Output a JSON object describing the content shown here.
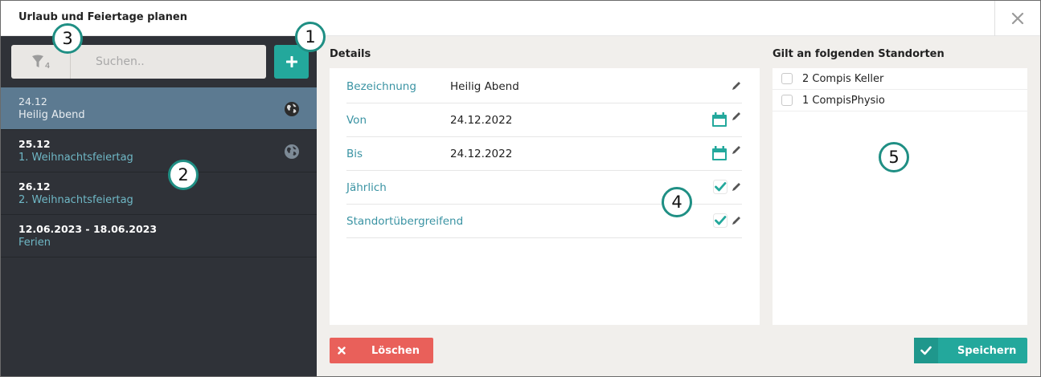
{
  "dialog": {
    "title": "Urlaub und Feiertage planen",
    "close_icon": "close-icon"
  },
  "sidebar": {
    "filter_count": "4",
    "search_placeholder": "Suchen..",
    "items": [
      {
        "date": "24.12",
        "name": "Heilig Abend",
        "icon": "globe-icon",
        "selected": true
      },
      {
        "date": "25.12",
        "name": "1. Weihnachtsfeiertag",
        "icon": "globe-icon",
        "selected": false
      },
      {
        "date": "26.12",
        "name": "2. Weihnachtsfeiertag",
        "selected": false
      },
      {
        "date": "12.06.2023 - 18.06.2023",
        "name": "Ferien",
        "selected": false
      }
    ]
  },
  "details": {
    "heading": "Details",
    "rows": [
      {
        "label": "Bezeichnung",
        "value": "Heilig Abend"
      },
      {
        "label": "Von",
        "value": "24.12.2022"
      },
      {
        "label": "Bis",
        "value": "24.12.2022"
      },
      {
        "label": "Jährlich",
        "checked": true
      },
      {
        "label": "Standortübergreifend",
        "checked": true
      }
    ]
  },
  "locations": {
    "heading": "Gilt an folgenden Standorten",
    "items": [
      {
        "label": "2 Compis Keller",
        "checked": false
      },
      {
        "label": "1 CompisPhysio",
        "checked": false
      }
    ]
  },
  "actions": {
    "delete_label": "Löschen",
    "save_label": "Speichern"
  },
  "callouts": [
    "1",
    "2",
    "3",
    "4",
    "5"
  ],
  "colors": {
    "accent": "#23a89c",
    "danger": "#e9605a",
    "sidebar_bg": "#2f3238",
    "selected_bg": "#5c7a91",
    "label_teal": "#3a93a3"
  }
}
